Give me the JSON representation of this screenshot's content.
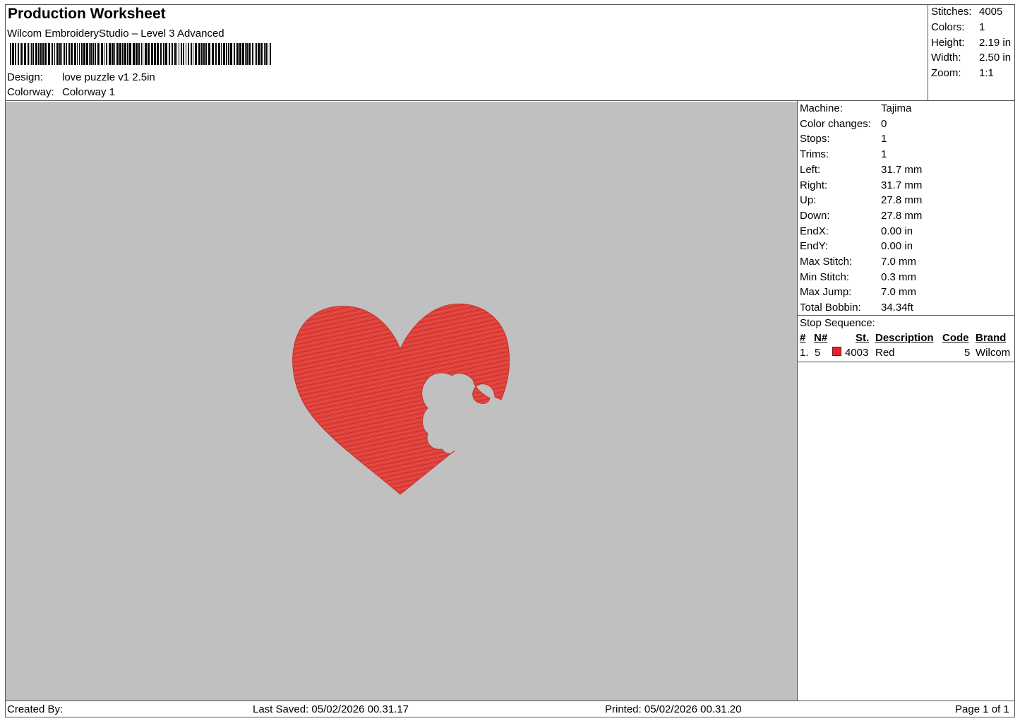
{
  "header": {
    "title": "Production Worksheet",
    "software": "Wilcom EmbroideryStudio – Level 3 Advanced",
    "design_label": "Design:",
    "design_value": "love puzzle v1 2.5in",
    "colorway_label": "Colorway:",
    "colorway_value": "Colorway 1"
  },
  "summary": {
    "stitches_label": "Stitches:",
    "stitches_value": "4005",
    "colors_label": "Colors:",
    "colors_value": "1",
    "height_label": "Height:",
    "height_value": "2.19 in",
    "width_label": "Width:",
    "width_value": "2.50 in",
    "zoom_label": "Zoom:",
    "zoom_value": "1:1"
  },
  "machine_info": [
    {
      "label": "Machine:",
      "value": "Tajima"
    },
    {
      "label": "Color changes:",
      "value": "0"
    },
    {
      "label": "Stops:",
      "value": "1"
    },
    {
      "label": "Trims:",
      "value": "1"
    },
    {
      "label": "Left:",
      "value": "31.7 mm"
    },
    {
      "label": "Right:",
      "value": "31.7 mm"
    },
    {
      "label": "Up:",
      "value": "27.8 mm"
    },
    {
      "label": "Down:",
      "value": "27.8 mm"
    },
    {
      "label": "EndX:",
      "value": "0.00 in"
    },
    {
      "label": "EndY:",
      "value": "0.00 in"
    },
    {
      "label": "Max Stitch:",
      "value": "7.0 mm"
    },
    {
      "label": "Min Stitch:",
      "value": "0.3 mm"
    },
    {
      "label": "Max Jump:",
      "value": "7.0 mm"
    },
    {
      "label": "Total Bobbin:",
      "value": "34.34ft"
    }
  ],
  "stop_sequence": {
    "title": "Stop Sequence:",
    "headers": {
      "num": "#",
      "n": "N#",
      "st": "St.",
      "description": "Description",
      "code": "Code",
      "brand": "Brand"
    },
    "rows": [
      {
        "num": "1.",
        "n": "5",
        "swatch_color": "#e8222a",
        "st": "4003",
        "description": "Red",
        "code": "5",
        "brand": "Wilcom"
      }
    ]
  },
  "design_colors": {
    "canvas_bg": "#c0c0c0",
    "thread": "#e0413b"
  },
  "footer": {
    "created_by": "Created By:",
    "last_saved": "Last Saved: 05/02/2026 00.31.17",
    "printed": "Printed: 05/02/2026 00.31.20",
    "page": "Page 1 of 1"
  }
}
